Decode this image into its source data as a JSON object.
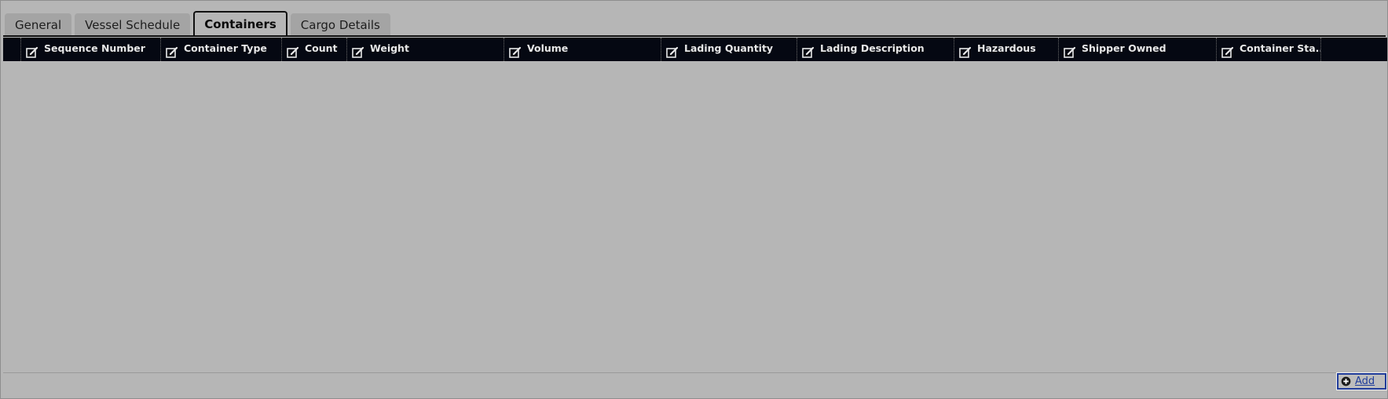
{
  "tabs": [
    {
      "label": "General",
      "active": false
    },
    {
      "label": "Vessel Schedule",
      "active": false
    },
    {
      "label": "Containers",
      "active": true
    },
    {
      "label": "Cargo Details",
      "active": false
    }
  ],
  "grid": {
    "columns": [
      {
        "label": "Sequence Number",
        "icon": "edit-icon"
      },
      {
        "label": "Container Type",
        "icon": "edit-icon"
      },
      {
        "label": "Count",
        "icon": "edit-icon"
      },
      {
        "label": "Weight",
        "icon": "edit-icon"
      },
      {
        "label": "Volume",
        "icon": "edit-icon"
      },
      {
        "label": "Lading Quantity",
        "icon": "edit-icon"
      },
      {
        "label": "Lading Description",
        "icon": "edit-icon"
      },
      {
        "label": "Hazardous",
        "icon": "edit-icon"
      },
      {
        "label": "Shipper Owned",
        "icon": "edit-icon"
      },
      {
        "label": "Container Sta...",
        "icon": "edit-icon"
      }
    ],
    "rows": []
  },
  "footer": {
    "add_label": "Add",
    "add_icon": "plus-circle-icon"
  },
  "colors": {
    "header_bg": "#050812",
    "link": "#1e3c9a",
    "panel_bg": "#b6b6b6"
  }
}
